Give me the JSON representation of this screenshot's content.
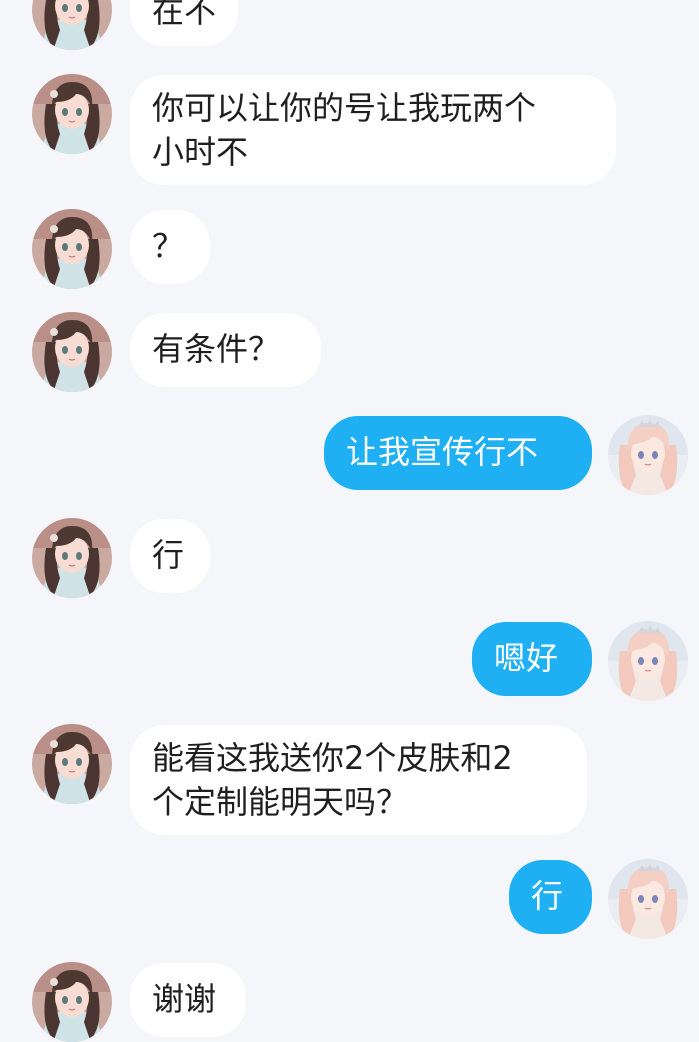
{
  "colors": {
    "background": "#f4f6f9",
    "incoming_bubble": "#ffffff",
    "outgoing_bubble": "#1eb0f2",
    "incoming_text": "#1f1f1f",
    "outgoing_text": "#ffffff"
  },
  "messages": [
    {
      "side": "left",
      "avatar": "friend-avatar",
      "text": "在不"
    },
    {
      "side": "left",
      "avatar": "friend-avatar",
      "text": "你可以让你的号让我玩两个\n小时不"
    },
    {
      "side": "left",
      "avatar": "friend-avatar",
      "text": "？"
    },
    {
      "side": "left",
      "avatar": "friend-avatar",
      "text": "有条件？"
    },
    {
      "side": "right",
      "avatar": "self-avatar",
      "text": "让我宣传行不"
    },
    {
      "side": "left",
      "avatar": "friend-avatar",
      "text": "行"
    },
    {
      "side": "right",
      "avatar": "self-avatar",
      "text": "嗯好"
    },
    {
      "side": "left",
      "avatar": "friend-avatar",
      "text": "能看这我送你2个皮肤和2\n个定制能明天吗？"
    },
    {
      "side": "right",
      "avatar": "self-avatar",
      "text": "行"
    },
    {
      "side": "left",
      "avatar": "friend-avatar",
      "text": "谢谢"
    }
  ]
}
